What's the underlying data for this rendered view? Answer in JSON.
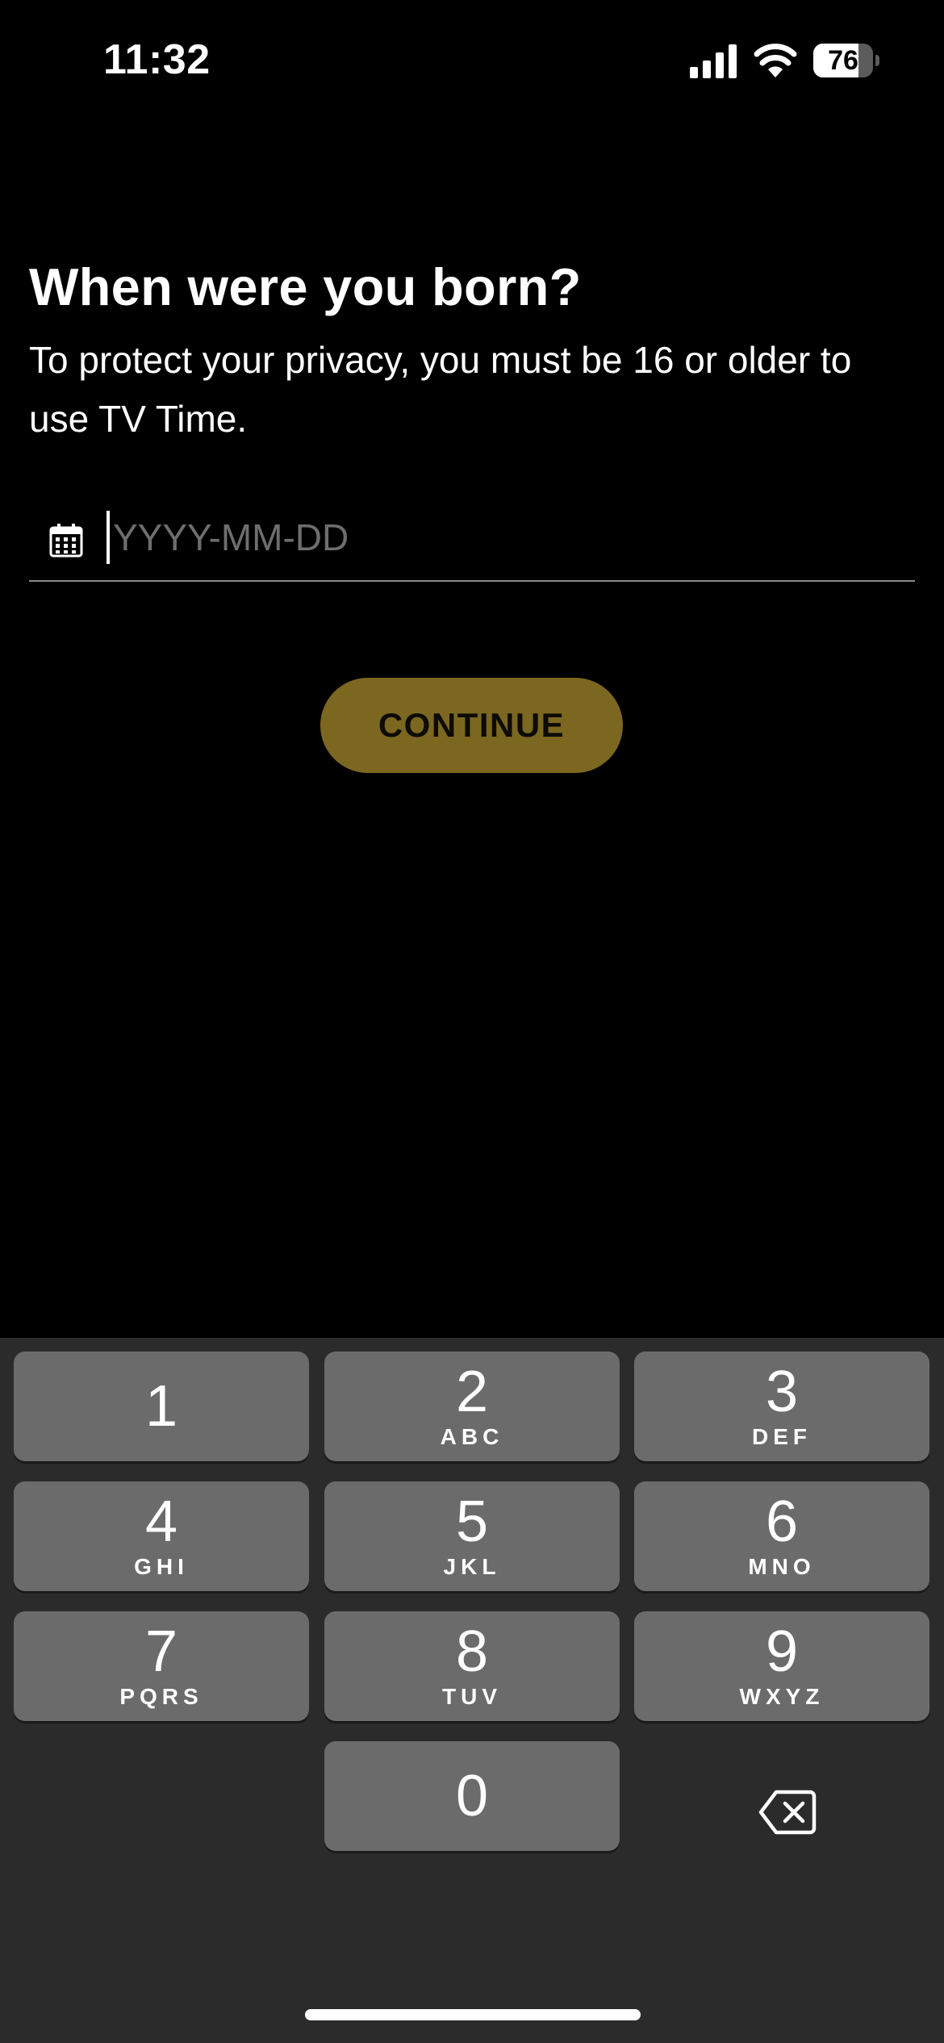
{
  "status_bar": {
    "time": "11:32",
    "battery_level": "76",
    "battery_fraction": 0.76
  },
  "page": {
    "title": "When were you born?",
    "subtitle": "To protect your privacy, you must be 16 or older to use TV Time."
  },
  "date_field": {
    "placeholder": "YYYY-MM-DD",
    "value": "",
    "icon": "calendar-icon"
  },
  "continue_button": {
    "label": "CONTINUE",
    "color": "#7c6720"
  },
  "keypad": {
    "keys": [
      {
        "digit": "1",
        "letters": ""
      },
      {
        "digit": "2",
        "letters": "ABC"
      },
      {
        "digit": "3",
        "letters": "DEF"
      },
      {
        "digit": "4",
        "letters": "GHI"
      },
      {
        "digit": "5",
        "letters": "JKL"
      },
      {
        "digit": "6",
        "letters": "MNO"
      },
      {
        "digit": "7",
        "letters": "PQRS"
      },
      {
        "digit": "8",
        "letters": "TUV"
      },
      {
        "digit": "9",
        "letters": "WXYZ"
      },
      {
        "digit": "0",
        "letters": ""
      }
    ],
    "backspace_icon": "backspace-icon"
  }
}
